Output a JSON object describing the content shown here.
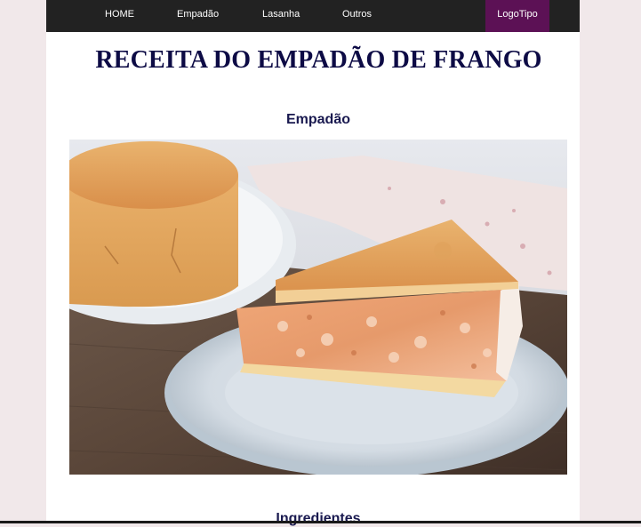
{
  "nav": {
    "items": [
      "HOME",
      "Empadão",
      "Lasanha",
      "Outros"
    ],
    "logo": "LogoTipo"
  },
  "page_title": "RECEITA DO EMPADÃO DE FRANGO",
  "sections": {
    "image_heading": "Empadão",
    "ingredients_heading": "Ingredientes"
  },
  "colors": {
    "navbar": "#222222",
    "logo_bg": "#5c1155",
    "title": "#0d0b45",
    "page_bg": "#f1e8ea"
  }
}
